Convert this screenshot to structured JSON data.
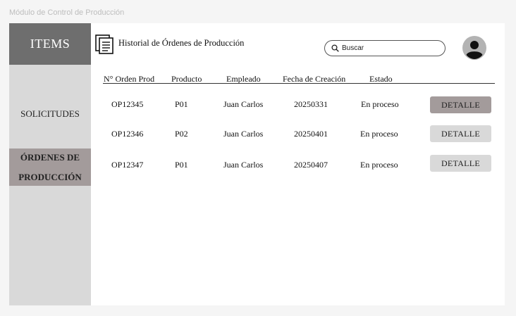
{
  "frame": {
    "title": "Módulo de Control de Producción"
  },
  "sidebar": {
    "header": "ITEMS",
    "items": [
      {
        "label": "SOLICITUDES"
      },
      {
        "label_line1": "ÓRDENES DE",
        "label_line2": "PRODUCCIÓN",
        "active": true
      }
    ]
  },
  "header": {
    "title": "Historial de Órdenes de Producción",
    "doc_icon": "document-list-icon",
    "search_icon": "magnifier-icon",
    "search_placeholder": "Buscar",
    "avatar_icon": "user-avatar-icon"
  },
  "table": {
    "columns": [
      "N° Orden Prod",
      "Producto",
      "Empleado",
      "Fecha de Creación",
      "Estado"
    ],
    "rows": [
      {
        "orden": "OP12345",
        "producto": "P01",
        "empleado": "Juan Carlos",
        "fecha": "20250331",
        "estado": "En proceso",
        "action": "DETALLE"
      },
      {
        "orden": "OP12346",
        "producto": "P02",
        "empleado": "Juan Carlos",
        "fecha": "20250401",
        "estado": "En proceso",
        "action": "DETALLE"
      },
      {
        "orden": "OP12347",
        "producto": "P01",
        "empleado": "Juan Carlos",
        "fecha": "20250407",
        "estado": "En proceso",
        "action": "DETALLE"
      }
    ]
  },
  "colors": {
    "sidebar_bg": "#d9d9d9",
    "sidebar_header_bg": "#6e6e6e",
    "active_bg": "#a39b9b",
    "button_bg": "#d9d9d9"
  }
}
